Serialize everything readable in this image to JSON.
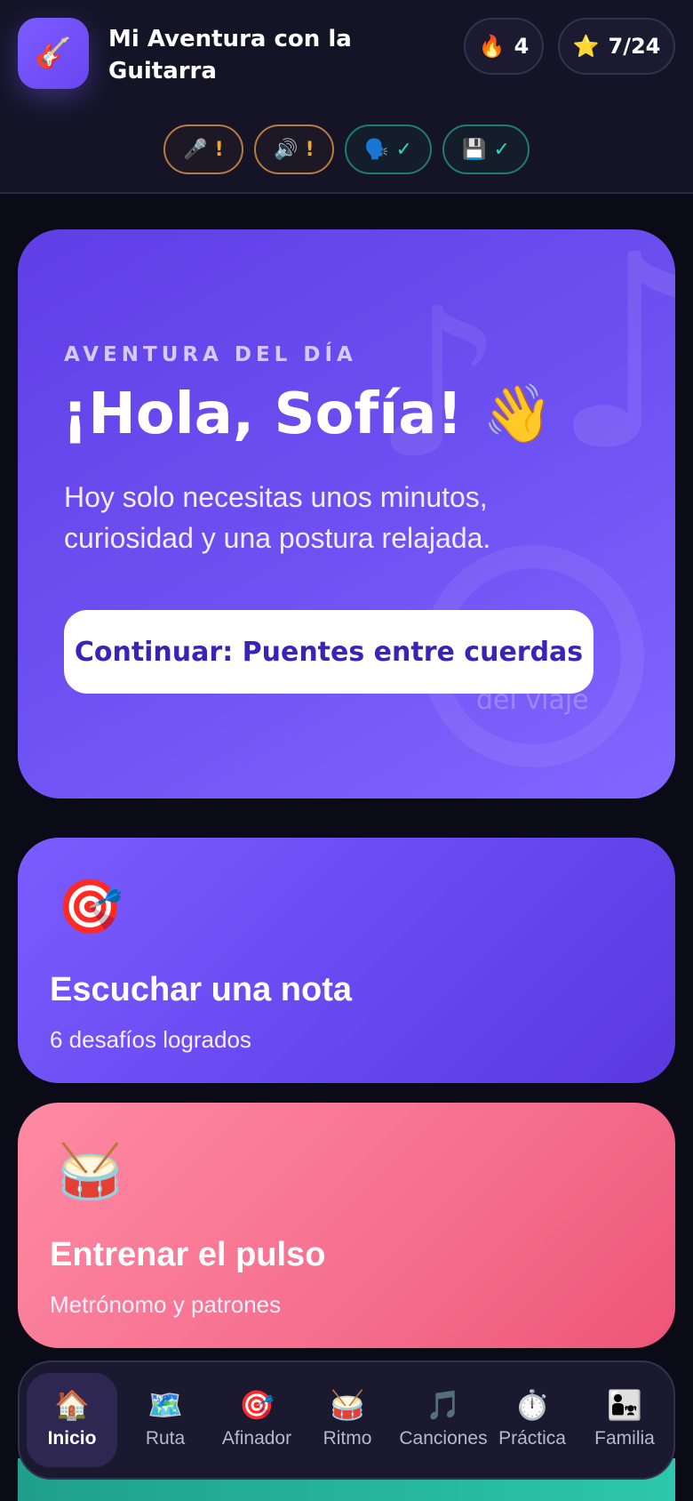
{
  "header": {
    "app_logo_icon": "guitar-icon",
    "app_logo_glyph": "🎸",
    "title": "Mi Aventura con la Guitarra",
    "streak": {
      "icon": "🔥",
      "value": "4"
    },
    "stars": {
      "icon": "⭐",
      "value": "7/24"
    }
  },
  "permissions": [
    {
      "name": "microphone",
      "icon": "🎤",
      "mark": "!",
      "state": "warning"
    },
    {
      "name": "sound",
      "icon": "🔊",
      "mark": "!",
      "state": "warning"
    },
    {
      "name": "voice",
      "icon": "🗣️",
      "mark": "✓",
      "state": "ok"
    },
    {
      "name": "save",
      "icon": "💾",
      "mark": "✓",
      "state": "ok"
    }
  ],
  "hero": {
    "kicker": "AVENTURA DEL DÍA",
    "title": "¡Hola, Sofía! 👋",
    "text": "Hoy solo necesitas unos minutos, curiosidad y una postura relajada.",
    "button": "Continuar: Puentes entre cuerdas",
    "deco_text": "del viaje"
  },
  "cards": [
    {
      "emoji": "🎯",
      "title": "Escuchar una nota",
      "subtitle": "6 desafíos logrados"
    },
    {
      "emoji": "🥁",
      "title": "Entrenar el pulso",
      "subtitle": "Metrónomo y patrones"
    }
  ],
  "nav": [
    {
      "icon": "🏠",
      "label": "Inicio",
      "active": true
    },
    {
      "icon": "🗺️",
      "label": "Ruta"
    },
    {
      "icon": "🎯",
      "label": "Afinador"
    },
    {
      "icon": "🥁",
      "label": "Ritmo"
    },
    {
      "icon": "🎵",
      "label": "Canciones"
    },
    {
      "icon": "⏱️",
      "label": "Práctica"
    },
    {
      "icon": "👨‍👧",
      "label": "Familia"
    }
  ],
  "colors": {
    "accent": "#7c5cff",
    "rhythm": "#f56e8d",
    "background": "#0b0a17",
    "ok": "#2fd3c2",
    "warn": "#f5a623"
  }
}
